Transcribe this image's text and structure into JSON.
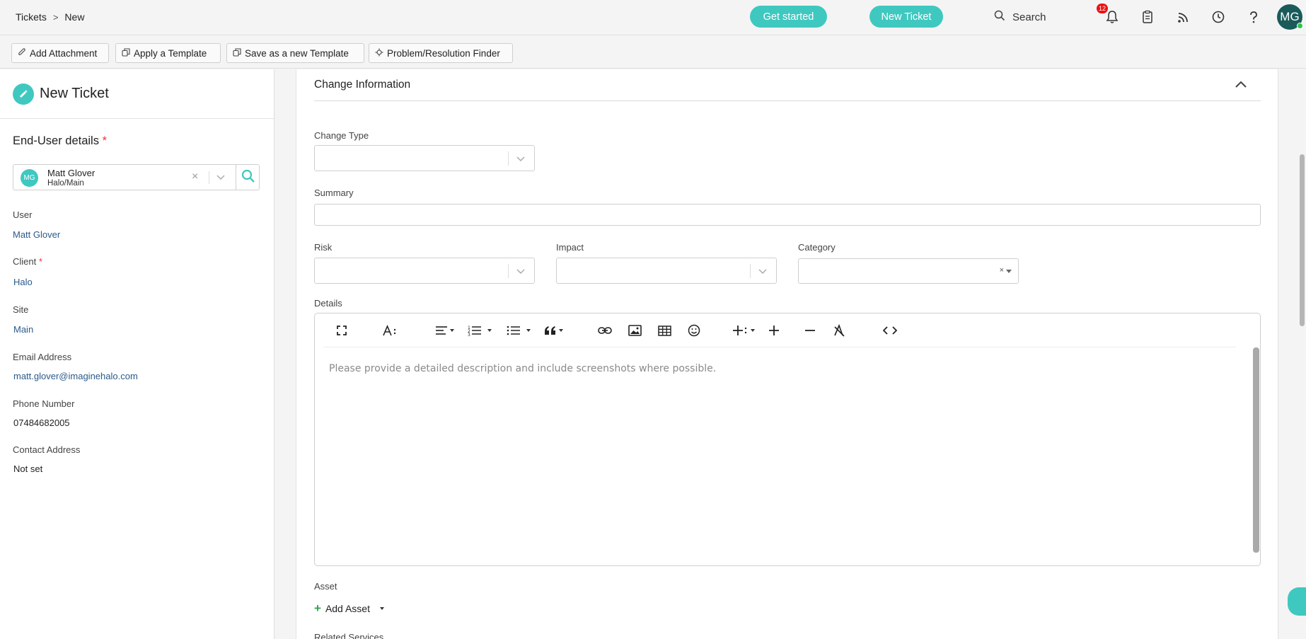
{
  "breadcrumb": {
    "root": "Tickets",
    "separator": ">",
    "current": "New"
  },
  "header": {
    "get_started_label": "Get started",
    "new_ticket_label": "New Ticket",
    "search_label": "Search",
    "notification_count": "12",
    "user_initials": "MG",
    "icons": [
      "bell-icon",
      "clipboard-icon",
      "rss-icon",
      "clock-icon",
      "help-icon"
    ]
  },
  "toolbar": {
    "add_attachment": "Add Attachment",
    "apply_template": "Apply a Template",
    "save_template": "Save as a new Template",
    "problem_finder": "Problem/Resolution Finder"
  },
  "left": {
    "title": "New Ticket",
    "enduser_section": "End-User details",
    "required_mark": "*",
    "picker": {
      "initials": "MG",
      "name": "Matt Glover",
      "sub": "Halo/Main",
      "clear": "×"
    },
    "fields": [
      {
        "label": "User",
        "value": "Matt Glover",
        "required": false,
        "link": true
      },
      {
        "label": "Client",
        "value": "Halo",
        "required": true,
        "link": true
      },
      {
        "label": "Site",
        "value": "Main",
        "required": false,
        "link": true
      },
      {
        "label": "Email Address",
        "value": "matt.glover@imaginehalo.com",
        "required": false,
        "link": true
      },
      {
        "label": "Phone Number",
        "value": "07484682005",
        "required": false,
        "link": false
      },
      {
        "label": "Contact Address",
        "value": "Not set",
        "required": false,
        "link": false
      }
    ]
  },
  "main": {
    "section_title": "Change Information",
    "change_type_label": "Change Type",
    "change_type_value": "",
    "summary_label": "Summary",
    "summary_value": "",
    "risk_label": "Risk",
    "impact_label": "Impact",
    "category_label": "Category",
    "category_clear": "×",
    "details_label": "Details",
    "details_placeholder": "Please provide a detailed description and include screenshots where possible.",
    "asset_label": "Asset",
    "add_asset_label": "Add Asset",
    "related_services_label": "Related Services"
  },
  "colors": {
    "accent": "#3fc8c0",
    "avatar": "#1a5b5a",
    "link": "#2a5a8a",
    "required": "#e33333",
    "badge": "#e11111"
  }
}
